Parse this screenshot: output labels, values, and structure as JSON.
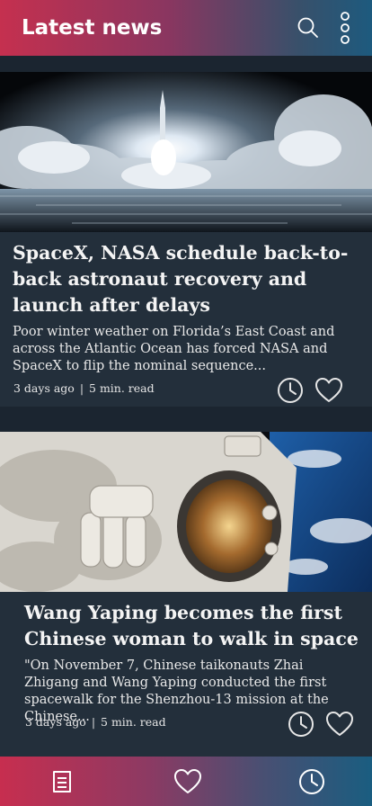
{
  "app_bar": {
    "title": "Latest news",
    "search_icon": "search-icon",
    "more_icon": "more-vertical-icon"
  },
  "articles": [
    {
      "image": "rocket-launch-above-clouds-photo",
      "headline": "SpaceX, NASA schedule back-to-back astronaut recovery and launch after delays",
      "summary": "Poor winter weather on Florida’s East Coast and across the Atlantic Ocean has forced NASA and SpaceX to flip the nominal sequence...",
      "age": "3 days ago",
      "separator": "|",
      "read_time": "5 min. read"
    },
    {
      "image": "astronaut-spacewalk-photo",
      "headline": "Wang Yaping becomes the first Chinese woman to walk in space",
      "summary": "\"On November 7, Chinese taikonauts Zhai Zhigang and Wang Yaping conducted the first spacewalk for the Shenzhou-13 mission at the Chinese...",
      "age": "3 days ago",
      "separator": "|",
      "read_time": "5 min. read"
    }
  ],
  "bottom_nav": {
    "items": [
      "news-document-icon",
      "heart-icon",
      "clock-icon"
    ],
    "active": "news-document-icon"
  },
  "colors": {
    "gradient_start": "#c5304f",
    "gradient_end": "#1d5a7e",
    "background": "#1b2530",
    "card": "#232f3b"
  }
}
